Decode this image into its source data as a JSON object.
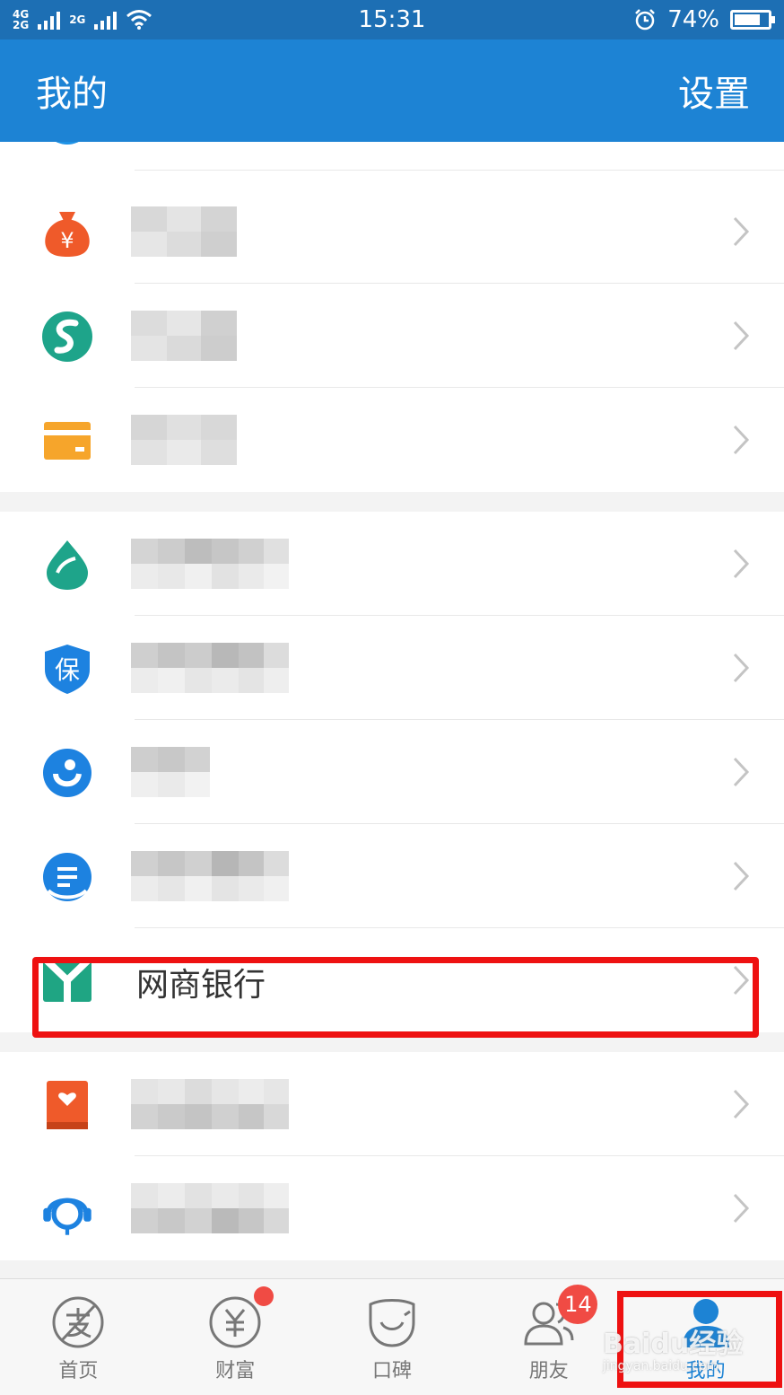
{
  "status_bar": {
    "net_top": "4G",
    "net_bottom": "2G",
    "net2": "2G",
    "time": "15:31",
    "battery_text": "74%",
    "battery_level": 0.74
  },
  "header": {
    "title": "我的",
    "settings_label": "设置"
  },
  "list": {
    "highlighted_item_label": "网商银行"
  },
  "tabs": [
    {
      "label": "首页",
      "icon": "alipay-icon"
    },
    {
      "label": "财富",
      "icon": "yuan-icon",
      "dot_badge": true
    },
    {
      "label": "口碑",
      "icon": "koubei-icon"
    },
    {
      "label": "朋友",
      "icon": "friends-icon",
      "badge_count": "14"
    },
    {
      "label": "我的",
      "icon": "person-icon",
      "active": true
    }
  ],
  "watermark": {
    "main": "Baidu经验",
    "sub": "jingyan.baidu.com"
  },
  "colors": {
    "header": "#1d83d4",
    "status": "#1d6fb4",
    "badge": "#f04b44",
    "highlight": "#ee1111"
  }
}
